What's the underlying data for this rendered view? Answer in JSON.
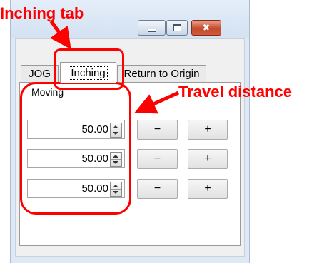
{
  "window": {
    "caption_buttons": [
      {
        "name": "minimize",
        "icon": "minimize-icon"
      },
      {
        "name": "maximize",
        "icon": "maximize-icon"
      },
      {
        "name": "close",
        "icon": "close-icon",
        "glyph": "✖",
        "color": "#c44a2c"
      }
    ]
  },
  "tabs": [
    {
      "label": "JOG",
      "selected": false
    },
    {
      "label": "Inching",
      "selected": true
    },
    {
      "label": "Return to Origin",
      "selected": false
    }
  ],
  "panel": {
    "group_label": "Moving",
    "rows": [
      {
        "value": "50.00",
        "minus_label": "−",
        "plus_label": "+"
      },
      {
        "value": "50.00",
        "minus_label": "−",
        "plus_label": "+"
      },
      {
        "value": "50.00",
        "minus_label": "−",
        "plus_label": "+"
      }
    ]
  },
  "annotations": {
    "inching_tab": "Inching tab",
    "travel_distance": "Travel distance",
    "color": "#ff0000"
  }
}
